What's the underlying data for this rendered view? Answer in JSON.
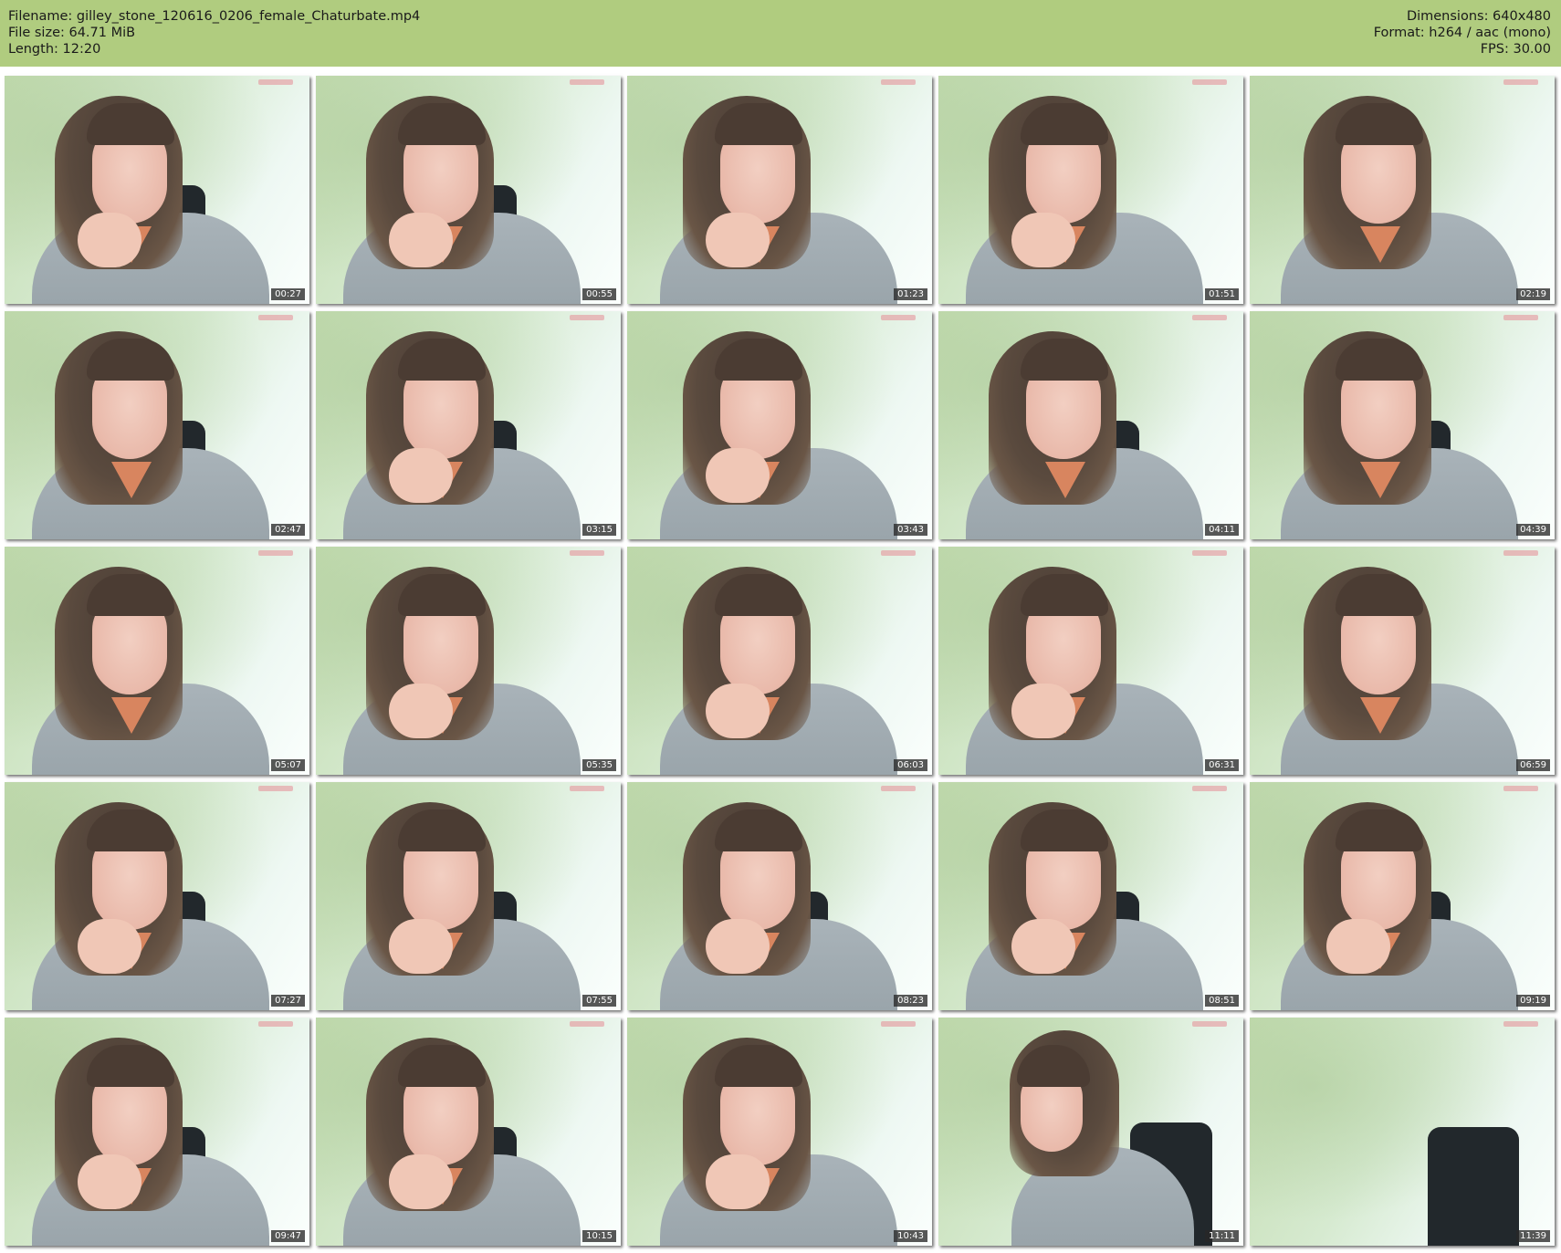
{
  "header": {
    "filename_label": "Filename: gilley_stone_120616_0206_female_Chaturbate.mp4",
    "filesize_label": "File size: 64.71 MiB",
    "length_label": "Length: 12:20",
    "dimensions_label": "Dimensions: 640x480",
    "format_label": "Format: h264 / aac (mono)",
    "fps_label": "FPS: 30.00",
    "background_color": "#b0cc7f"
  },
  "thumbnails": [
    {
      "timestamp": "00:27"
    },
    {
      "timestamp": "00:55"
    },
    {
      "timestamp": "01:23"
    },
    {
      "timestamp": "01:51"
    },
    {
      "timestamp": "02:19"
    },
    {
      "timestamp": "02:47"
    },
    {
      "timestamp": "03:15"
    },
    {
      "timestamp": "03:43"
    },
    {
      "timestamp": "04:11"
    },
    {
      "timestamp": "04:39"
    },
    {
      "timestamp": "05:07"
    },
    {
      "timestamp": "05:35"
    },
    {
      "timestamp": "06:03"
    },
    {
      "timestamp": "06:31"
    },
    {
      "timestamp": "06:59"
    },
    {
      "timestamp": "07:27"
    },
    {
      "timestamp": "07:55"
    },
    {
      "timestamp": "08:23"
    },
    {
      "timestamp": "08:51"
    },
    {
      "timestamp": "09:19"
    },
    {
      "timestamp": "09:47"
    },
    {
      "timestamp": "10:15"
    },
    {
      "timestamp": "10:43"
    },
    {
      "timestamp": "11:11"
    },
    {
      "timestamp": "11:39"
    }
  ]
}
